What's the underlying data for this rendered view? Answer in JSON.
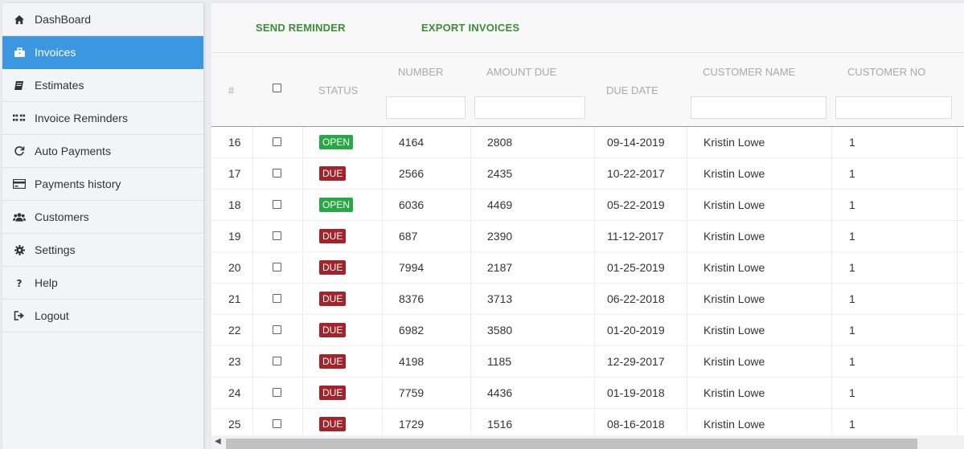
{
  "sidebar": {
    "items": [
      {
        "label": "DashBoard",
        "icon": "home-icon",
        "active": false
      },
      {
        "label": "Invoices",
        "icon": "briefcase-icon",
        "active": true
      },
      {
        "label": "Estimates",
        "icon": "book-icon",
        "active": false
      },
      {
        "label": "Invoice Reminders",
        "icon": "grid-icon",
        "active": false
      },
      {
        "label": "Auto Payments",
        "icon": "refresh-icon",
        "active": false
      },
      {
        "label": "Payments history",
        "icon": "credit-card-icon",
        "active": false
      },
      {
        "label": "Customers",
        "icon": "users-icon",
        "active": false
      },
      {
        "label": "Settings",
        "icon": "gear-icon",
        "active": false
      },
      {
        "label": "Help",
        "icon": "question-icon",
        "active": false
      },
      {
        "label": "Logout",
        "icon": "logout-icon",
        "active": false
      }
    ]
  },
  "toolbar": {
    "send_reminder": "SEND REMINDER",
    "export_invoices": "EXPORT INVOICES"
  },
  "table": {
    "headers": {
      "index": "#",
      "status": "STATUS",
      "number": "NUMBER",
      "amount_due": "AMOUNT DUE",
      "due_date": "DUE DATE",
      "customer_name": "CUSTOMER NAME",
      "customer_no": "CUSTOMER NO"
    },
    "status_colors": {
      "OPEN": "#28a745",
      "DUE": "#a4232b"
    },
    "rows": [
      {
        "index": "16",
        "status": "OPEN",
        "number": "4164",
        "amount": "2808",
        "due_date": "09-14-2019",
        "customer": "Kristin Lowe",
        "customer_no": "1"
      },
      {
        "index": "17",
        "status": "DUE",
        "number": "2566",
        "amount": "2435",
        "due_date": "10-22-2017",
        "customer": "Kristin Lowe",
        "customer_no": "1"
      },
      {
        "index": "18",
        "status": "OPEN",
        "number": "6036",
        "amount": "4469",
        "due_date": "05-22-2019",
        "customer": "Kristin Lowe",
        "customer_no": "1"
      },
      {
        "index": "19",
        "status": "DUE",
        "number": "687",
        "amount": "2390",
        "due_date": "11-12-2017",
        "customer": "Kristin Lowe",
        "customer_no": "1"
      },
      {
        "index": "20",
        "status": "DUE",
        "number": "7994",
        "amount": "2187",
        "due_date": "01-25-2019",
        "customer": "Kristin Lowe",
        "customer_no": "1"
      },
      {
        "index": "21",
        "status": "DUE",
        "number": "8376",
        "amount": "3713",
        "due_date": "06-22-2018",
        "customer": "Kristin Lowe",
        "customer_no": "1"
      },
      {
        "index": "22",
        "status": "DUE",
        "number": "6982",
        "amount": "3580",
        "due_date": "01-20-2019",
        "customer": "Kristin Lowe",
        "customer_no": "1"
      },
      {
        "index": "23",
        "status": "DUE",
        "number": "4198",
        "amount": "1185",
        "due_date": "12-29-2017",
        "customer": "Kristin Lowe",
        "customer_no": "1"
      },
      {
        "index": "24",
        "status": "DUE",
        "number": "7759",
        "amount": "4436",
        "due_date": "01-19-2018",
        "customer": "Kristin Lowe",
        "customer_no": "1"
      },
      {
        "index": "25",
        "status": "DUE",
        "number": "1729",
        "amount": "1516",
        "due_date": "08-16-2018",
        "customer": "Kristin Lowe",
        "customer_no": "1"
      }
    ]
  },
  "colors": {
    "accent": "#3a97e0",
    "action_green": "#3a8e34"
  }
}
